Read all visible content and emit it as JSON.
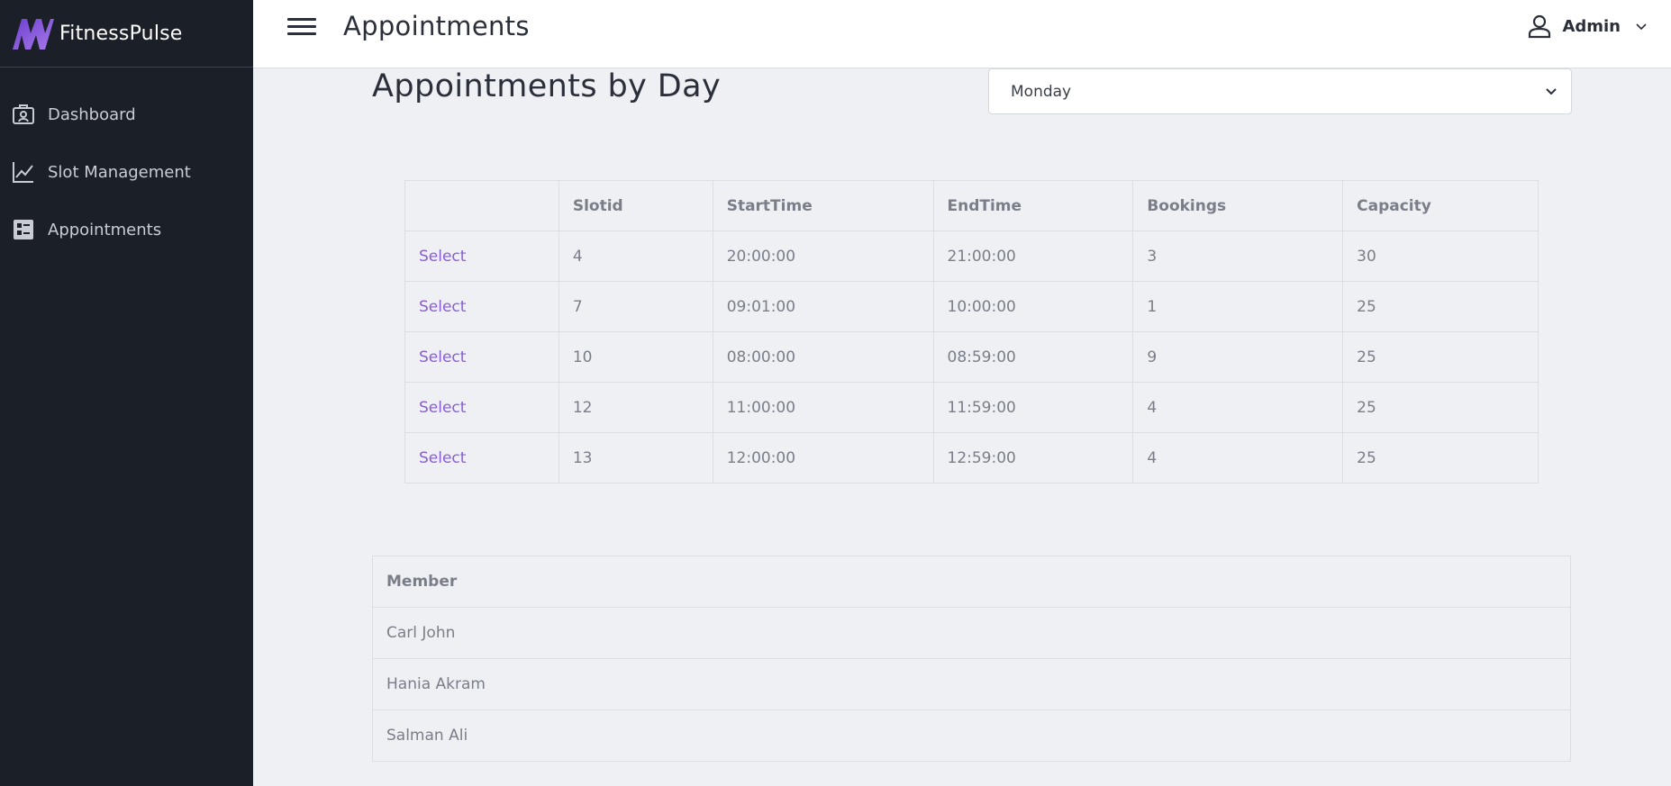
{
  "app": {
    "name": "FitnessPulse"
  },
  "sidebar": {
    "items": [
      {
        "label": "Dashboard",
        "icon": "badge-icon"
      },
      {
        "label": "Slot Management",
        "icon": "line-chart-icon"
      },
      {
        "label": "Appointments",
        "icon": "list-icon"
      }
    ]
  },
  "topbar": {
    "title": "Appointments",
    "user": "Admin"
  },
  "main": {
    "heading": "Appointments by Day",
    "day_select": {
      "value": "Monday"
    },
    "slots_table": {
      "headers": [
        "",
        "Slotid",
        "StartTime",
        "EndTime",
        "Bookings",
        "Capacity"
      ],
      "rows": [
        {
          "action": "Select",
          "slotid": "4",
          "start": "20:00:00",
          "end": "21:00:00",
          "bookings": "3",
          "capacity": "30"
        },
        {
          "action": "Select",
          "slotid": "7",
          "start": "09:01:00",
          "end": "10:00:00",
          "bookings": "1",
          "capacity": "25"
        },
        {
          "action": "Select",
          "slotid": "10",
          "start": "08:00:00",
          "end": "08:59:00",
          "bookings": "9",
          "capacity": "25"
        },
        {
          "action": "Select",
          "slotid": "12",
          "start": "11:00:00",
          "end": "11:59:00",
          "bookings": "4",
          "capacity": "25"
        },
        {
          "action": "Select",
          "slotid": "13",
          "start": "12:00:00",
          "end": "12:59:00",
          "bookings": "4",
          "capacity": "25"
        }
      ]
    },
    "members_table": {
      "header": "Member",
      "rows": [
        "Carl John",
        "Hania Akram",
        "Salman Ali"
      ]
    }
  },
  "colors": {
    "sidebar_bg": "#1b1f27",
    "accent": "#8a5cd6",
    "page_bg": "#eff0f4"
  }
}
